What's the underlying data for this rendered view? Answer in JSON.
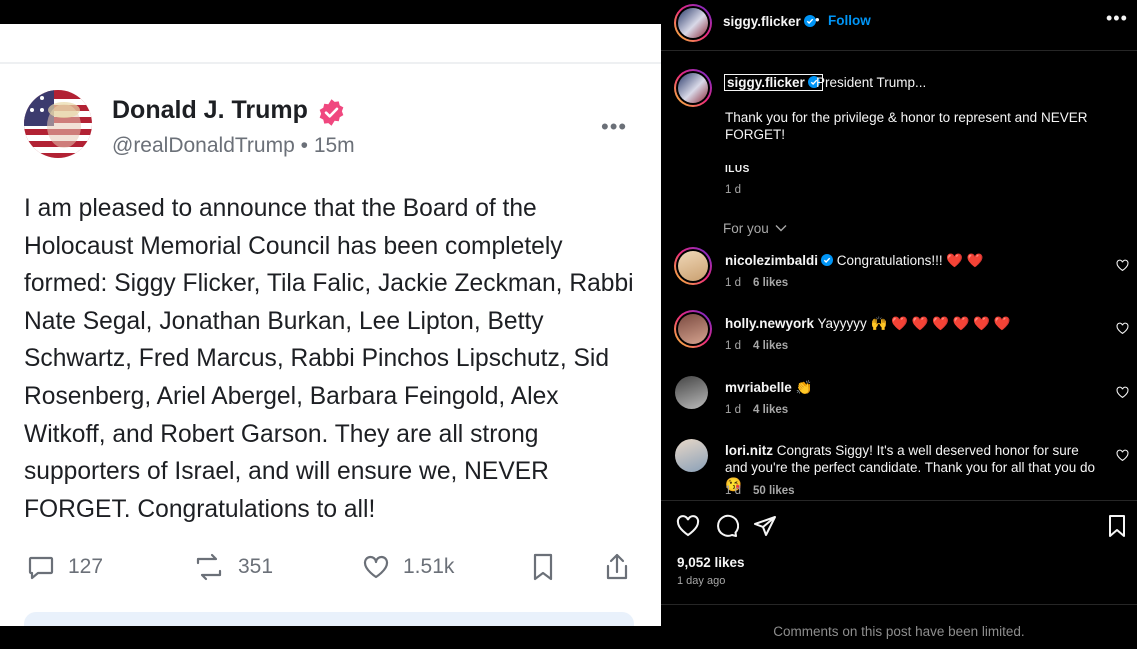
{
  "tweet": {
    "name": "Donald J. Trump",
    "handle": "@realDonaldTrump",
    "time": "15m",
    "more_glyph": "•••",
    "text": "I am pleased to announce that the Board of the Holocaust Memorial Council has been completely formed: Siggy Flicker, Tila Falic, Jackie Zeckman, Rabbi Nate Segal, Jonathan Burkan, Lee Lipton, Betty Schwartz, Fred Marcus, Rabbi Pinchos Lipschutz, Sid Rosenberg, Ariel Abergel, Barbara Feingold, Alex Witkoff, and Robert Garson. They are all strong supporters of Israel, and will ensure we, NEVER FORGET. Congratulations to all!",
    "replies": "127",
    "retruths": "351",
    "likes": "1.51k",
    "verify_color": "#f0487f",
    "icons": [
      "avatar-flag-portrait-icon",
      "verified-badge-icon",
      "reply-icon",
      "retruth-icon",
      "like-icon",
      "bookmark-icon",
      "share-icon"
    ]
  },
  "instagram": {
    "username": "siggy.flicker",
    "follow_label": "Follow",
    "dot": "•",
    "more_glyph": "•••",
    "caption_lead": "President Trump...",
    "caption_body": "Thank you for the privilege & honor to represent and NEVER FORGET!",
    "caption_tag": "ILUS",
    "caption_time": "1 d",
    "for_you_label": "For you",
    "comments": [
      {
        "user": "nicolezimbaldi",
        "verified": true,
        "text": "Congratulations!!!",
        "emoji": "❤️ ❤️",
        "time": "1 d",
        "likes": "6 likes"
      },
      {
        "user": "holly.newyork",
        "verified": false,
        "text": "Yayyyyy",
        "emoji": "🙌 ❤️ ❤️ ❤️ ❤️ ❤️ ❤️",
        "time": "1 d",
        "likes": "4 likes"
      },
      {
        "user": "mvriabelle",
        "verified": false,
        "text": "",
        "emoji": "👏",
        "time": "1 d",
        "likes": "4 likes"
      },
      {
        "user": "lori.nitz",
        "verified": false,
        "text": "Congrats Siggy! It's a well deserved honor for sure and you're the perfect candidate. Thank you for all that you do",
        "emoji": "😘",
        "time": "1 d",
        "likes": "50 likes"
      }
    ],
    "post_likes": "9,052 likes",
    "post_time": "1 day ago",
    "limited_notice": "Comments on this post have been limited.",
    "accent": "#0095f6",
    "icons": [
      "heart-icon",
      "comment-icon",
      "share-icon",
      "save-icon",
      "chevron-down-icon",
      "verified-badge-icon",
      "ellipsis-icon"
    ]
  }
}
